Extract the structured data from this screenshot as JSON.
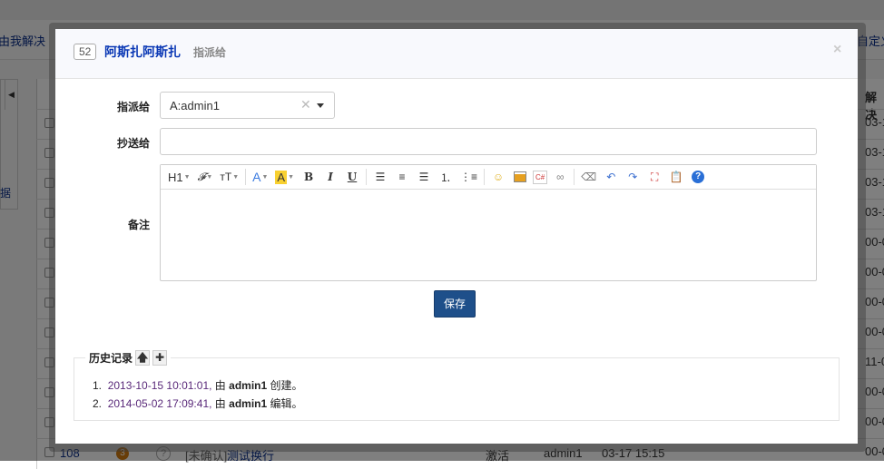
{
  "background": {
    "nav_left": "由我解决",
    "nav_right": "自定义",
    "side_text": "据",
    "column_header": "解决",
    "row_dates": [
      "03-1",
      "03-1",
      "03-1",
      "03-1",
      "00-0",
      "00-0",
      "00-0",
      "00-0",
      "11-0",
      "00-0",
      "00-0",
      "00-0"
    ],
    "last_row": {
      "id": "108",
      "badge": "3",
      "status_icon": "?",
      "tag": "[未确认]",
      "title": "测试换行",
      "state": "激活",
      "user": "admin1",
      "time": "03-17 15:15"
    }
  },
  "modal": {
    "id_badge": "52",
    "title": "阿斯扎阿斯扎",
    "subtitle": "指派给",
    "close": "×",
    "form": {
      "assign_label": "指派给",
      "assign_value": "A:admin1",
      "cc_label": "抄送给",
      "cc_value": "",
      "comment_label": "备注",
      "save_label": "保存"
    },
    "toolbar": [
      {
        "name": "heading",
        "glyph": "H1",
        "caret": true
      },
      {
        "name": "font-family",
        "glyph": "𝓕",
        "caret": true
      },
      {
        "name": "font-size",
        "glyph": "тT",
        "caret": true
      },
      {
        "name": "font-color",
        "glyph": "A",
        "caret": true
      },
      {
        "name": "highlight",
        "glyph": "A",
        "caret": true
      },
      {
        "name": "bold",
        "glyph": "B"
      },
      {
        "name": "italic",
        "glyph": "I"
      },
      {
        "name": "underline",
        "glyph": "U"
      }
    ],
    "history": {
      "legend": "历史记录",
      "entries": [
        {
          "num": "1.",
          "datetime": "2013-10-15 10:01:01,",
          "by": "由",
          "user": "admin1",
          "action": "创建。"
        },
        {
          "num": "2.",
          "datetime": "2014-05-02 17:09:41,",
          "by": "由",
          "user": "admin1",
          "action": "编辑。"
        }
      ]
    }
  },
  "colors": {
    "accent": "#1e4f8a",
    "title": "#0a38b5"
  }
}
